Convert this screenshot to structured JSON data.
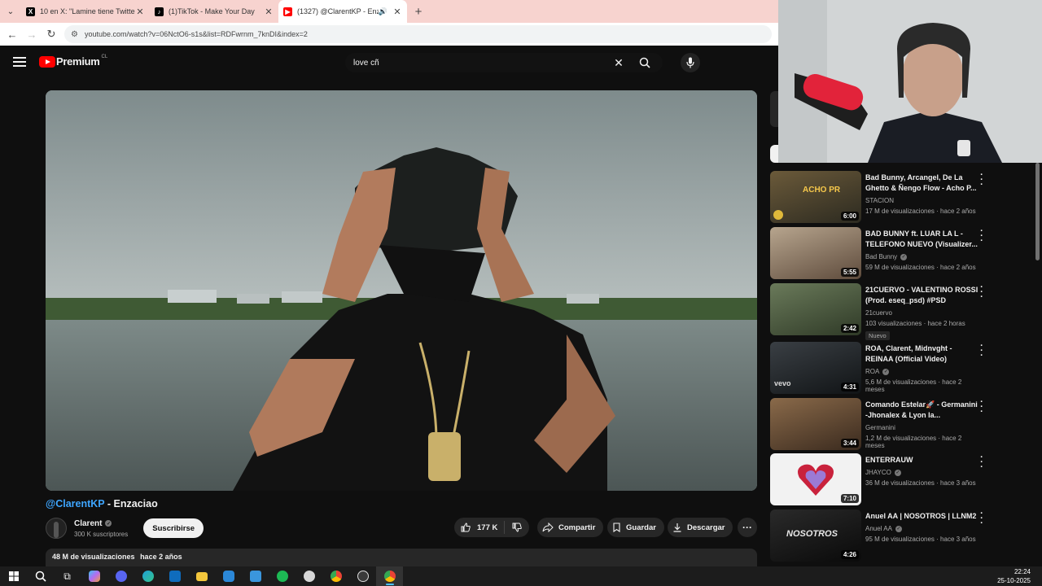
{
  "browser": {
    "tabs": [
      {
        "title": "10 en X: \"Lamine tiene Twitter...",
        "favicon": "x-icon",
        "color": "#000000"
      },
      {
        "title": "(1)TikTok - Make Your Day",
        "favicon": "tiktok-icon",
        "color": "#000000"
      },
      {
        "title": "(1327) @ClarentKP - Enzaci...",
        "favicon": "youtube-icon",
        "color": "#ff0000",
        "active": true
      }
    ],
    "url": "youtube.com/watch?v=06NctO6-s1s&list=RDFwrnm_7knDI&index=2"
  },
  "youtube": {
    "logo_text": "Premium",
    "country_code": "CL",
    "search_query": "love cñ"
  },
  "video": {
    "handle": "@ClarentKP",
    "title_sep": " - ",
    "title": "Enzaciao",
    "channel_name": "Clarent",
    "subscribers": "300 K suscriptores",
    "subscribe_label": "Suscribirse",
    "likes": "177 K",
    "share_label": "Compartir",
    "save_label": "Guardar",
    "download_label": "Descargar",
    "views": "48 M de visualizaciones",
    "age": "hace 2 años"
  },
  "sidebar": {
    "items": [
      {
        "title": "Bad Bunny, Arcangel, De La Ghetto & Ñengo Flow - Acho P...",
        "channel": "STACION",
        "verified": false,
        "stats": "17 M de visualizaciones · hace 2 años",
        "duration": "6:00",
        "badge": "",
        "thumb_text": "ACHO PR",
        "c1": "#6b5a3a",
        "c2": "#2c2a20"
      },
      {
        "title": "BAD BUNNY ft. LUAR LA L - TELEFONO NUEVO (Visualizer...",
        "channel": "Bad Bunny",
        "verified": true,
        "stats": "59 M de visualizaciones · hace 2 años",
        "duration": "5:55",
        "badge": "",
        "thumb_text": "",
        "c1": "#b7a58e",
        "c2": "#5e4b3c"
      },
      {
        "title": "21CUERVO - VALENTINO ROSSI (Prod. eseq_psd) #PSD",
        "channel": "21cuervo",
        "verified": false,
        "stats": "103 visualizaciones · hace 2 horas",
        "duration": "2:42",
        "badge": "Nuevo",
        "thumb_text": "",
        "c1": "#6a7a5a",
        "c2": "#2f3a27"
      },
      {
        "title": "ROA, Clarent, Midnvght - REINAA (Official Video)",
        "channel": "ROA",
        "verified": true,
        "stats": "5,6 M de visualizaciones · hace 2 meses",
        "duration": "4:31",
        "badge": "",
        "thumb_text": "vevo",
        "c1": "#3a3f44",
        "c2": "#111416"
      },
      {
        "title": "Comando Estelar🚀 - Germanini -Jhonalex & Lyon la...",
        "channel": "Germanini",
        "verified": false,
        "stats": "1,2 M de visualizaciones · hace 2 meses",
        "duration": "3:44",
        "badge": "",
        "thumb_text": "",
        "c1": "#8a6a4a",
        "c2": "#3a2a1e"
      },
      {
        "title": "ENTERRAUW",
        "channel": "JHAYCO",
        "verified": true,
        "stats": "36 M de visualizaciones · hace 3 años",
        "duration": "7:10",
        "badge": "",
        "thumb_text": "",
        "c1": "#f2f2f2",
        "c2": "#dcdcdc"
      },
      {
        "title": "Anuel AA | NOSOTROS | LLNM2",
        "channel": "Anuel AA",
        "verified": true,
        "stats": "95 M de visualizaciones · hace 3 años",
        "duration": "4:26",
        "badge": "",
        "thumb_text": "NOSOTROS",
        "c1": "#2a2a2a",
        "c2": "#0a0a0a"
      }
    ]
  },
  "taskbar": {
    "time": "22:24",
    "date": "25-10-2025",
    "apps": [
      {
        "name": "start-icon",
        "color": "#4cc2ff"
      },
      {
        "name": "search-icon",
        "color": "#ffffff"
      },
      {
        "name": "task-view-icon",
        "color": "#ffffff"
      },
      {
        "name": "copilot-icon",
        "color": "#7b8cff"
      },
      {
        "name": "discord-icon",
        "color": "#5865f2"
      },
      {
        "name": "edge-icon",
        "color": "#1fa0d8"
      },
      {
        "name": "outlook-icon",
        "color": "#0f6cbd"
      },
      {
        "name": "file-explorer-icon",
        "color": "#f3c63c"
      },
      {
        "name": "app-icon",
        "color": "#2b88d8"
      },
      {
        "name": "store-icon",
        "color": "#3a96dd"
      },
      {
        "name": "spotify-icon",
        "color": "#1db954"
      },
      {
        "name": "app2-icon",
        "color": "#d7d7d7"
      },
      {
        "name": "chrome-icon",
        "color": "#ea4335"
      },
      {
        "name": "obs-icon",
        "color": "#3a3a3a"
      },
      {
        "name": "chrome-active-icon",
        "color": "#34a853"
      }
    ]
  }
}
